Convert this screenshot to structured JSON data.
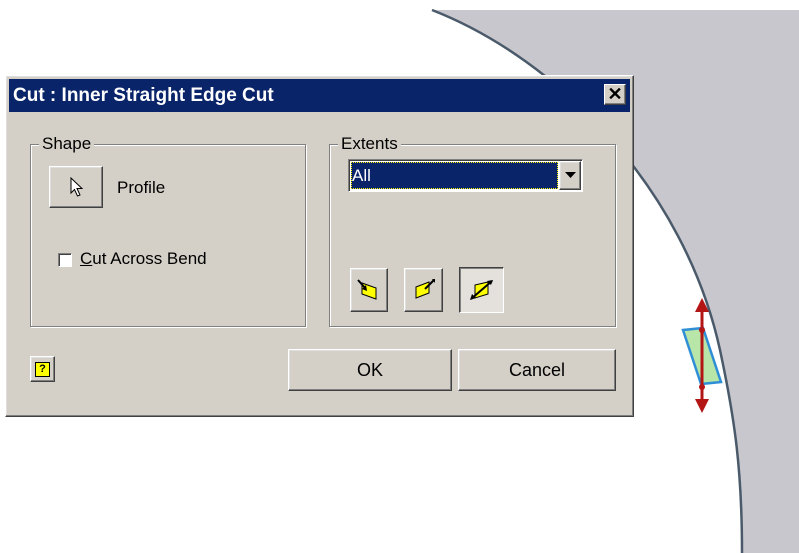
{
  "dialog": {
    "title": "Cut : Inner Straight Edge Cut",
    "close_label": "✕",
    "shape": {
      "group_label": "Shape",
      "profile_label": "Profile",
      "cut_across_bend_mnemonic": "C",
      "cut_across_bend_rest": "ut Across Bend",
      "cut_across_bend_checked": false
    },
    "extents": {
      "group_label": "Extents",
      "selected_value": "All",
      "direction_buttons": [
        {
          "name": "direction-1",
          "pressed": false
        },
        {
          "name": "direction-2",
          "pressed": false
        },
        {
          "name": "direction-both",
          "pressed": true
        }
      ]
    },
    "help_label": "?",
    "ok_label": "OK",
    "cancel_label": "Cancel"
  },
  "colors": {
    "titlebar": "#0a246a",
    "dialog_face": "#d4d0c8",
    "part_face": "#c8c7cd",
    "preview_fill": "#b8e6a8",
    "preview_edge": "#2f8fd6",
    "manipulator": "#b31515",
    "icon_yellow": "#ffff00"
  },
  "icons": [
    "cursor-icon",
    "help-icon",
    "close-icon",
    "dropdown-arrow-icon",
    "direction-icon"
  ]
}
